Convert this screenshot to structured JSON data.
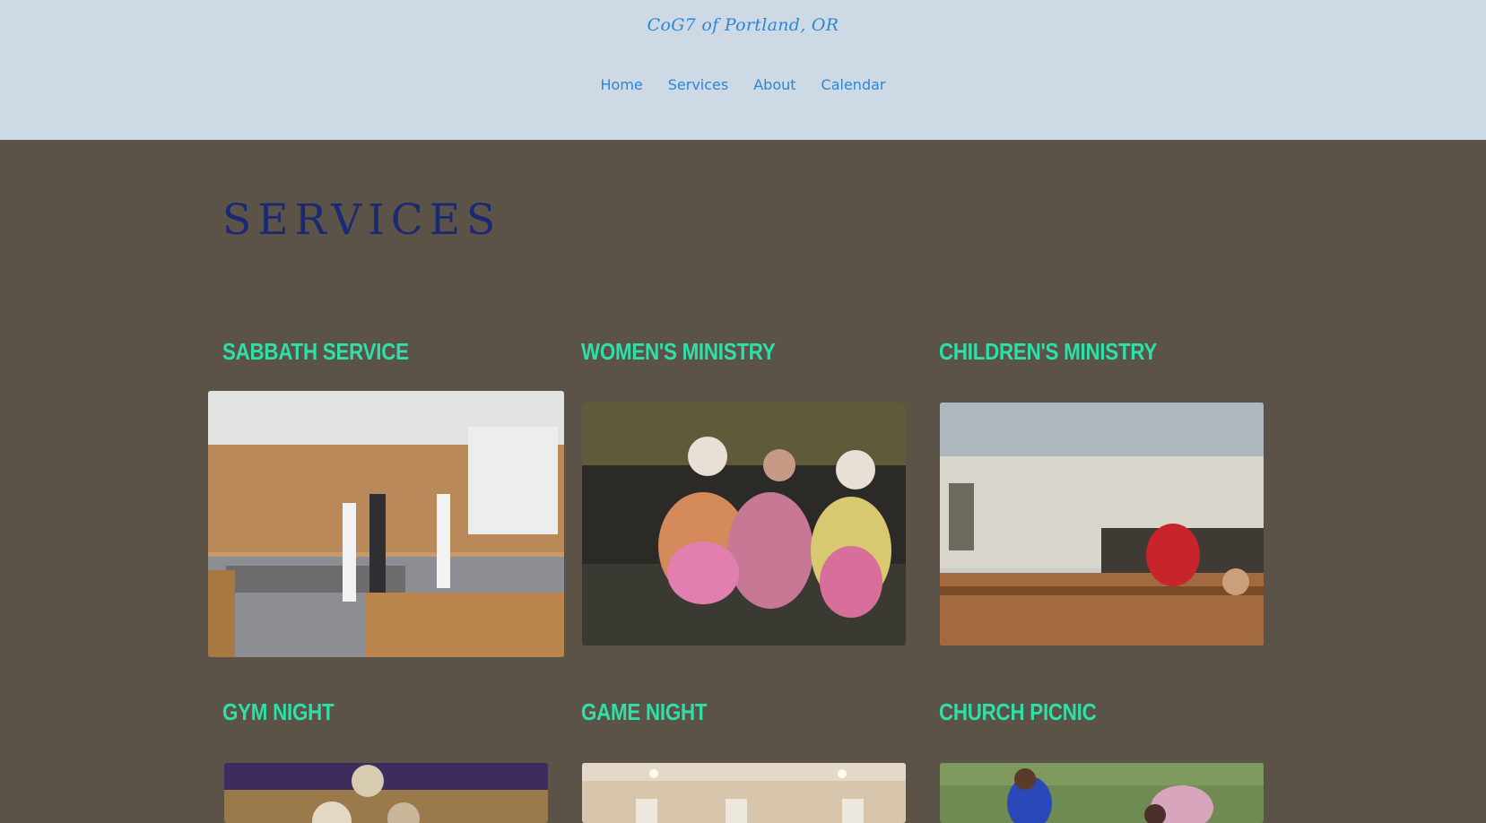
{
  "header": {
    "site_title": "CoG7 of Portland, OR",
    "nav": [
      {
        "label": "Home"
      },
      {
        "label": "Services"
      },
      {
        "label": "About"
      },
      {
        "label": "Calendar"
      }
    ]
  },
  "main": {
    "title": "SERVICES",
    "services": [
      {
        "title": "SABBATH SERVICE",
        "photo": "church-sanctuary-photo"
      },
      {
        "title": "WOMEN'S MINISTRY",
        "photo": "costumed-women-photo"
      },
      {
        "title": "CHILDREN'S MINISTRY",
        "photo": "children-pews-photo"
      },
      {
        "title": "GYM NIGHT",
        "photo": "gym-photo"
      },
      {
        "title": "GAME NIGHT",
        "photo": "game-room-photo"
      },
      {
        "title": "CHURCH PICNIC",
        "photo": "picnic-lawn-photo"
      }
    ]
  },
  "colors": {
    "header_bg": "#cddae5",
    "body_bg": "#5b5248",
    "link": "#2d86d4",
    "page_title": "#1a2a72",
    "card_title": "#2ee0a8"
  }
}
